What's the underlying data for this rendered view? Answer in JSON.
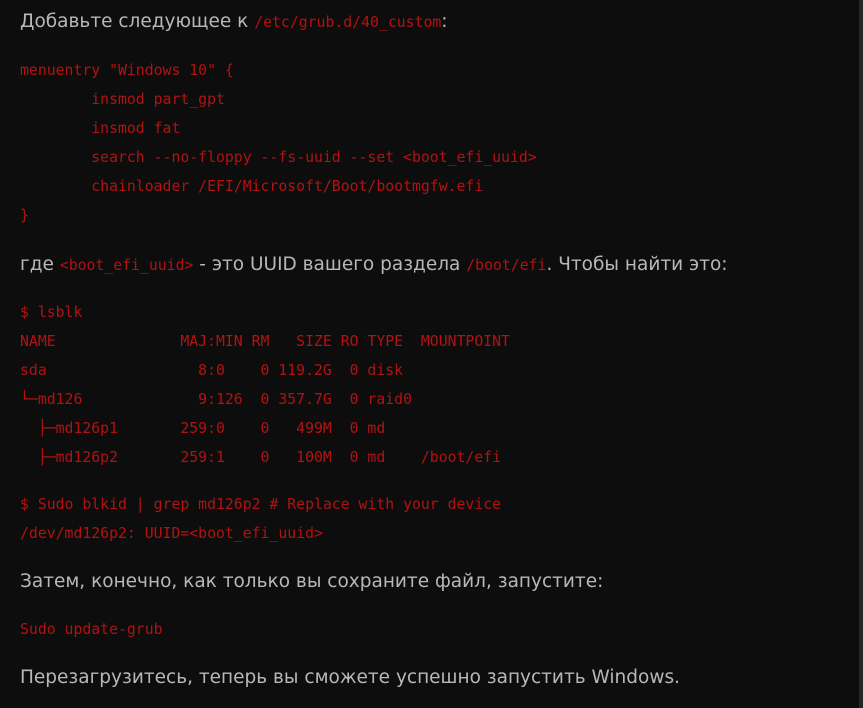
{
  "colors": {
    "background": "#0d0d0d",
    "text": "#b8b8b8",
    "code": "#b31212"
  },
  "intro": {
    "before": "Добавьте следующее к ",
    "path": "/etc/grub.d/40_custom",
    "after": ":"
  },
  "code_block_1": {
    "lines": [
      "menuentry \"Windows 10\" {",
      "        insmod part_gpt",
      "        insmod fat",
      "        search --no-floppy --fs-uuid --set <boot_efi_uuid>",
      "        chainloader /EFI/Microsoft/Boot/bootmgfw.efi",
      "}"
    ]
  },
  "where": {
    "before": "где ",
    "code1": "<boot_efi_uuid>",
    "middle": " - это UUID вашего раздела ",
    "code2": "/boot/efi",
    "after": ". Чтобы найти это:"
  },
  "code_block_2": {
    "lines": [
      "$ lsblk",
      "NAME              MAJ:MIN RM   SIZE RO TYPE  MOUNTPOINT",
      "sda                 8:0    0 119.2G  0 disk",
      "└─md126             9:126  0 357.7G  0 raid0",
      "  ├─md126p1       259:0    0   499M  0 md",
      "  ├─md126p2       259:1    0   100M  0 md    /boot/efi"
    ]
  },
  "code_block_3": {
    "lines": [
      "$ Sudo blkid | grep md126p2 # Replace with your device",
      "/dev/md126p2: UUID=<boot_efi_uuid>"
    ]
  },
  "then_text": "Затем, конечно, как только вы сохраните файл, запустите:",
  "code_block_4": {
    "lines": [
      "Sudo update-grub"
    ]
  },
  "reboot_text": "Перезагрузитесь, теперь вы сможете успешно запустить Windows."
}
